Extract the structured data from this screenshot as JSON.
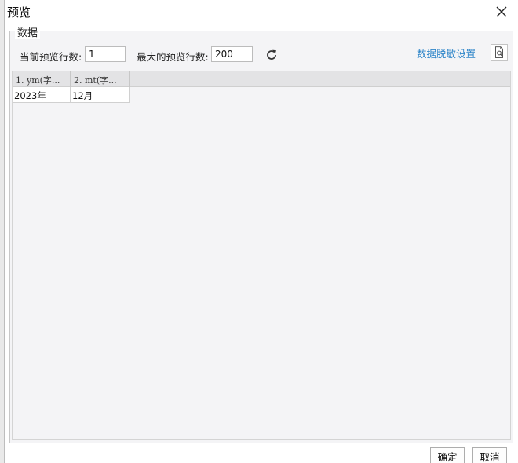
{
  "dialog": {
    "title": "预览",
    "close_icon": "close-icon"
  },
  "group": {
    "legend": "数据",
    "current_rows_label": "当前预览行数:",
    "current_rows_value": "1",
    "max_rows_label": "最大的预览行数:",
    "max_rows_value": "200",
    "refresh_icon": "refresh-icon",
    "desensitize_link": "数据脱敏设置",
    "preview_icon": "document-search-icon"
  },
  "table": {
    "columns": [
      "1. ym(字...",
      "2. mt(字..."
    ],
    "rows": [
      [
        "2023年",
        "12月"
      ]
    ]
  },
  "footer": {
    "ok_label": "确定",
    "cancel_label": "取消"
  }
}
